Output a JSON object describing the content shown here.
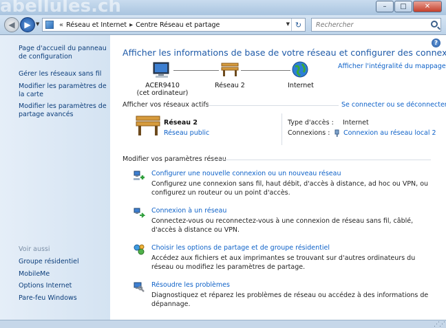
{
  "titlebar": {
    "watermark": "abellules.ch",
    "minimize_glyph": "–",
    "maximize_glyph": "□",
    "close_glyph": "✕"
  },
  "nav": {
    "breadcrumb_prefix": "«",
    "breadcrumb": [
      "Réseau et Internet",
      "Centre Réseau et partage"
    ],
    "separator": "▸",
    "search_placeholder": "Rechercher"
  },
  "sidebar": {
    "links": [
      "Page d'accueil du panneau de configuration",
      "Gérer les réseaux sans fil",
      "Modifier les paramètres de la carte",
      "Modifier les paramètres de partage avancés"
    ],
    "see_also_heading": "Voir aussi",
    "see_also": [
      "Groupe résidentiel",
      "MobileMe",
      "Options Internet",
      "Pare-feu Windows"
    ]
  },
  "main": {
    "heading": "Afficher les informations de base de votre réseau et configurer des connexions",
    "full_map_link": "Afficher l'intégralité du mappage",
    "map": {
      "computer_line1": "ACER9410",
      "computer_line2": "(cet ordinateur)",
      "network": "Réseau  2",
      "internet": "Internet"
    },
    "active_networks_title": "Afficher vos réseaux actifs",
    "connect_link": "Se connecter ou se déconnecter",
    "active": {
      "name": "Réseau  2",
      "type": "Réseau public",
      "access_label": "Type d'accès :",
      "access_value": "Internet",
      "connections_label": "Connexions :",
      "connection_value": "Connexion au réseau local 2"
    },
    "change_title": "Modifier vos paramètres réseau",
    "tasks": [
      {
        "title": "Configurer une nouvelle connexion ou un nouveau réseau",
        "desc": "Configurez une connexion sans fil, haut débit, d'accès à distance, ad hoc ou VPN, ou configurez un routeur ou un point d'accès."
      },
      {
        "title": "Connexion à un réseau",
        "desc": "Connectez-vous ou reconnectez-vous à une connexion de réseau sans fil, câblé, d'accès à distance ou VPN."
      },
      {
        "title": "Choisir les options de partage et de groupe résidentiel",
        "desc": "Accédez aux fichiers et aux imprimantes se trouvant sur d'autres ordinateurs du réseau ou modifiez les paramètres de partage."
      },
      {
        "title": "Résoudre les problèmes",
        "desc": "Diagnostiquez et réparez les problèmes de réseau ou accédez à des informations de dépannage."
      }
    ],
    "help_glyph": "?"
  }
}
